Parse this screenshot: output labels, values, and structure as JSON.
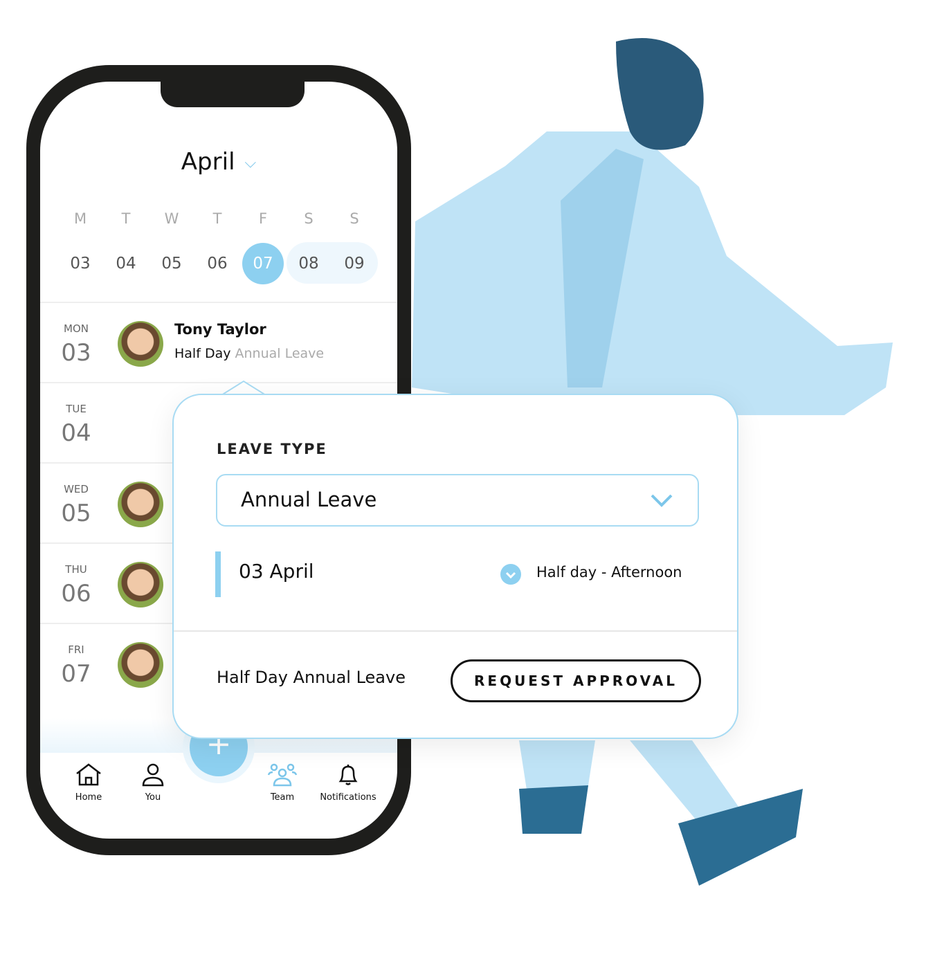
{
  "calendar": {
    "month": "April",
    "weekdays": [
      "M",
      "T",
      "W",
      "T",
      "F",
      "S",
      "S"
    ],
    "dates": [
      "03",
      "04",
      "05",
      "06",
      "07",
      "08",
      "09"
    ],
    "selected": "07"
  },
  "rows": [
    {
      "day": "MON",
      "num": "03",
      "name": "Tony Taylor",
      "type": "Half Day",
      "leave": "Annual Leave"
    },
    {
      "day": "TUE",
      "num": "04"
    },
    {
      "day": "WED",
      "num": "05"
    },
    {
      "day": "THU",
      "num": "06"
    },
    {
      "day": "FRI",
      "num": "07"
    }
  ],
  "nav": {
    "home": "Home",
    "you": "You",
    "team": "Team",
    "notifications": "Notifications",
    "add": "+"
  },
  "popup": {
    "label": "LEAVE TYPE",
    "selected": "Annual Leave",
    "date": "03 April",
    "option": "Half day - Afternoon",
    "summary": "Half Day Annual Leave",
    "button": "REQUEST APPROVAL"
  },
  "colors": {
    "accent": "#8dd0f0",
    "border": "#a8dbf3",
    "phone": "#1e1e1c"
  }
}
